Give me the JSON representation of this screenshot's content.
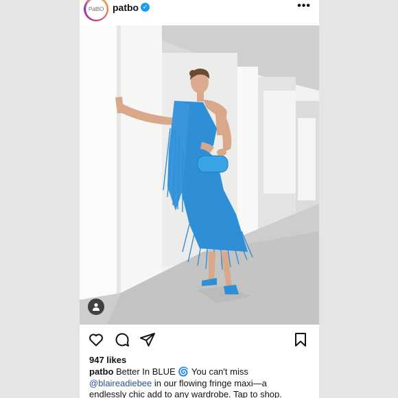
{
  "post": {
    "username": "patbo",
    "avatar_text": "PatBO",
    "more_label": "•••",
    "likes": "947 likes",
    "caption_user": "patbo",
    "caption_line1": "Better In BLUE 🌀 You can't miss",
    "caption_mention": "@blaireadiebee",
    "caption_line2": " in our flowing fringe maxi—a",
    "caption_line3": "endlessly chic add to any wardrobe. Tap to shop."
  },
  "icons": {
    "verified": "verified-badge-icon",
    "like": "heart-icon",
    "comment": "comment-bubble-icon",
    "share": "paper-plane-icon",
    "save": "bookmark-icon",
    "tag": "person-tag-icon"
  },
  "colors": {
    "dress_blue": "#2f8fd6",
    "verified_blue": "#1d9bf0",
    "mention_blue": "#2a4f8a"
  }
}
